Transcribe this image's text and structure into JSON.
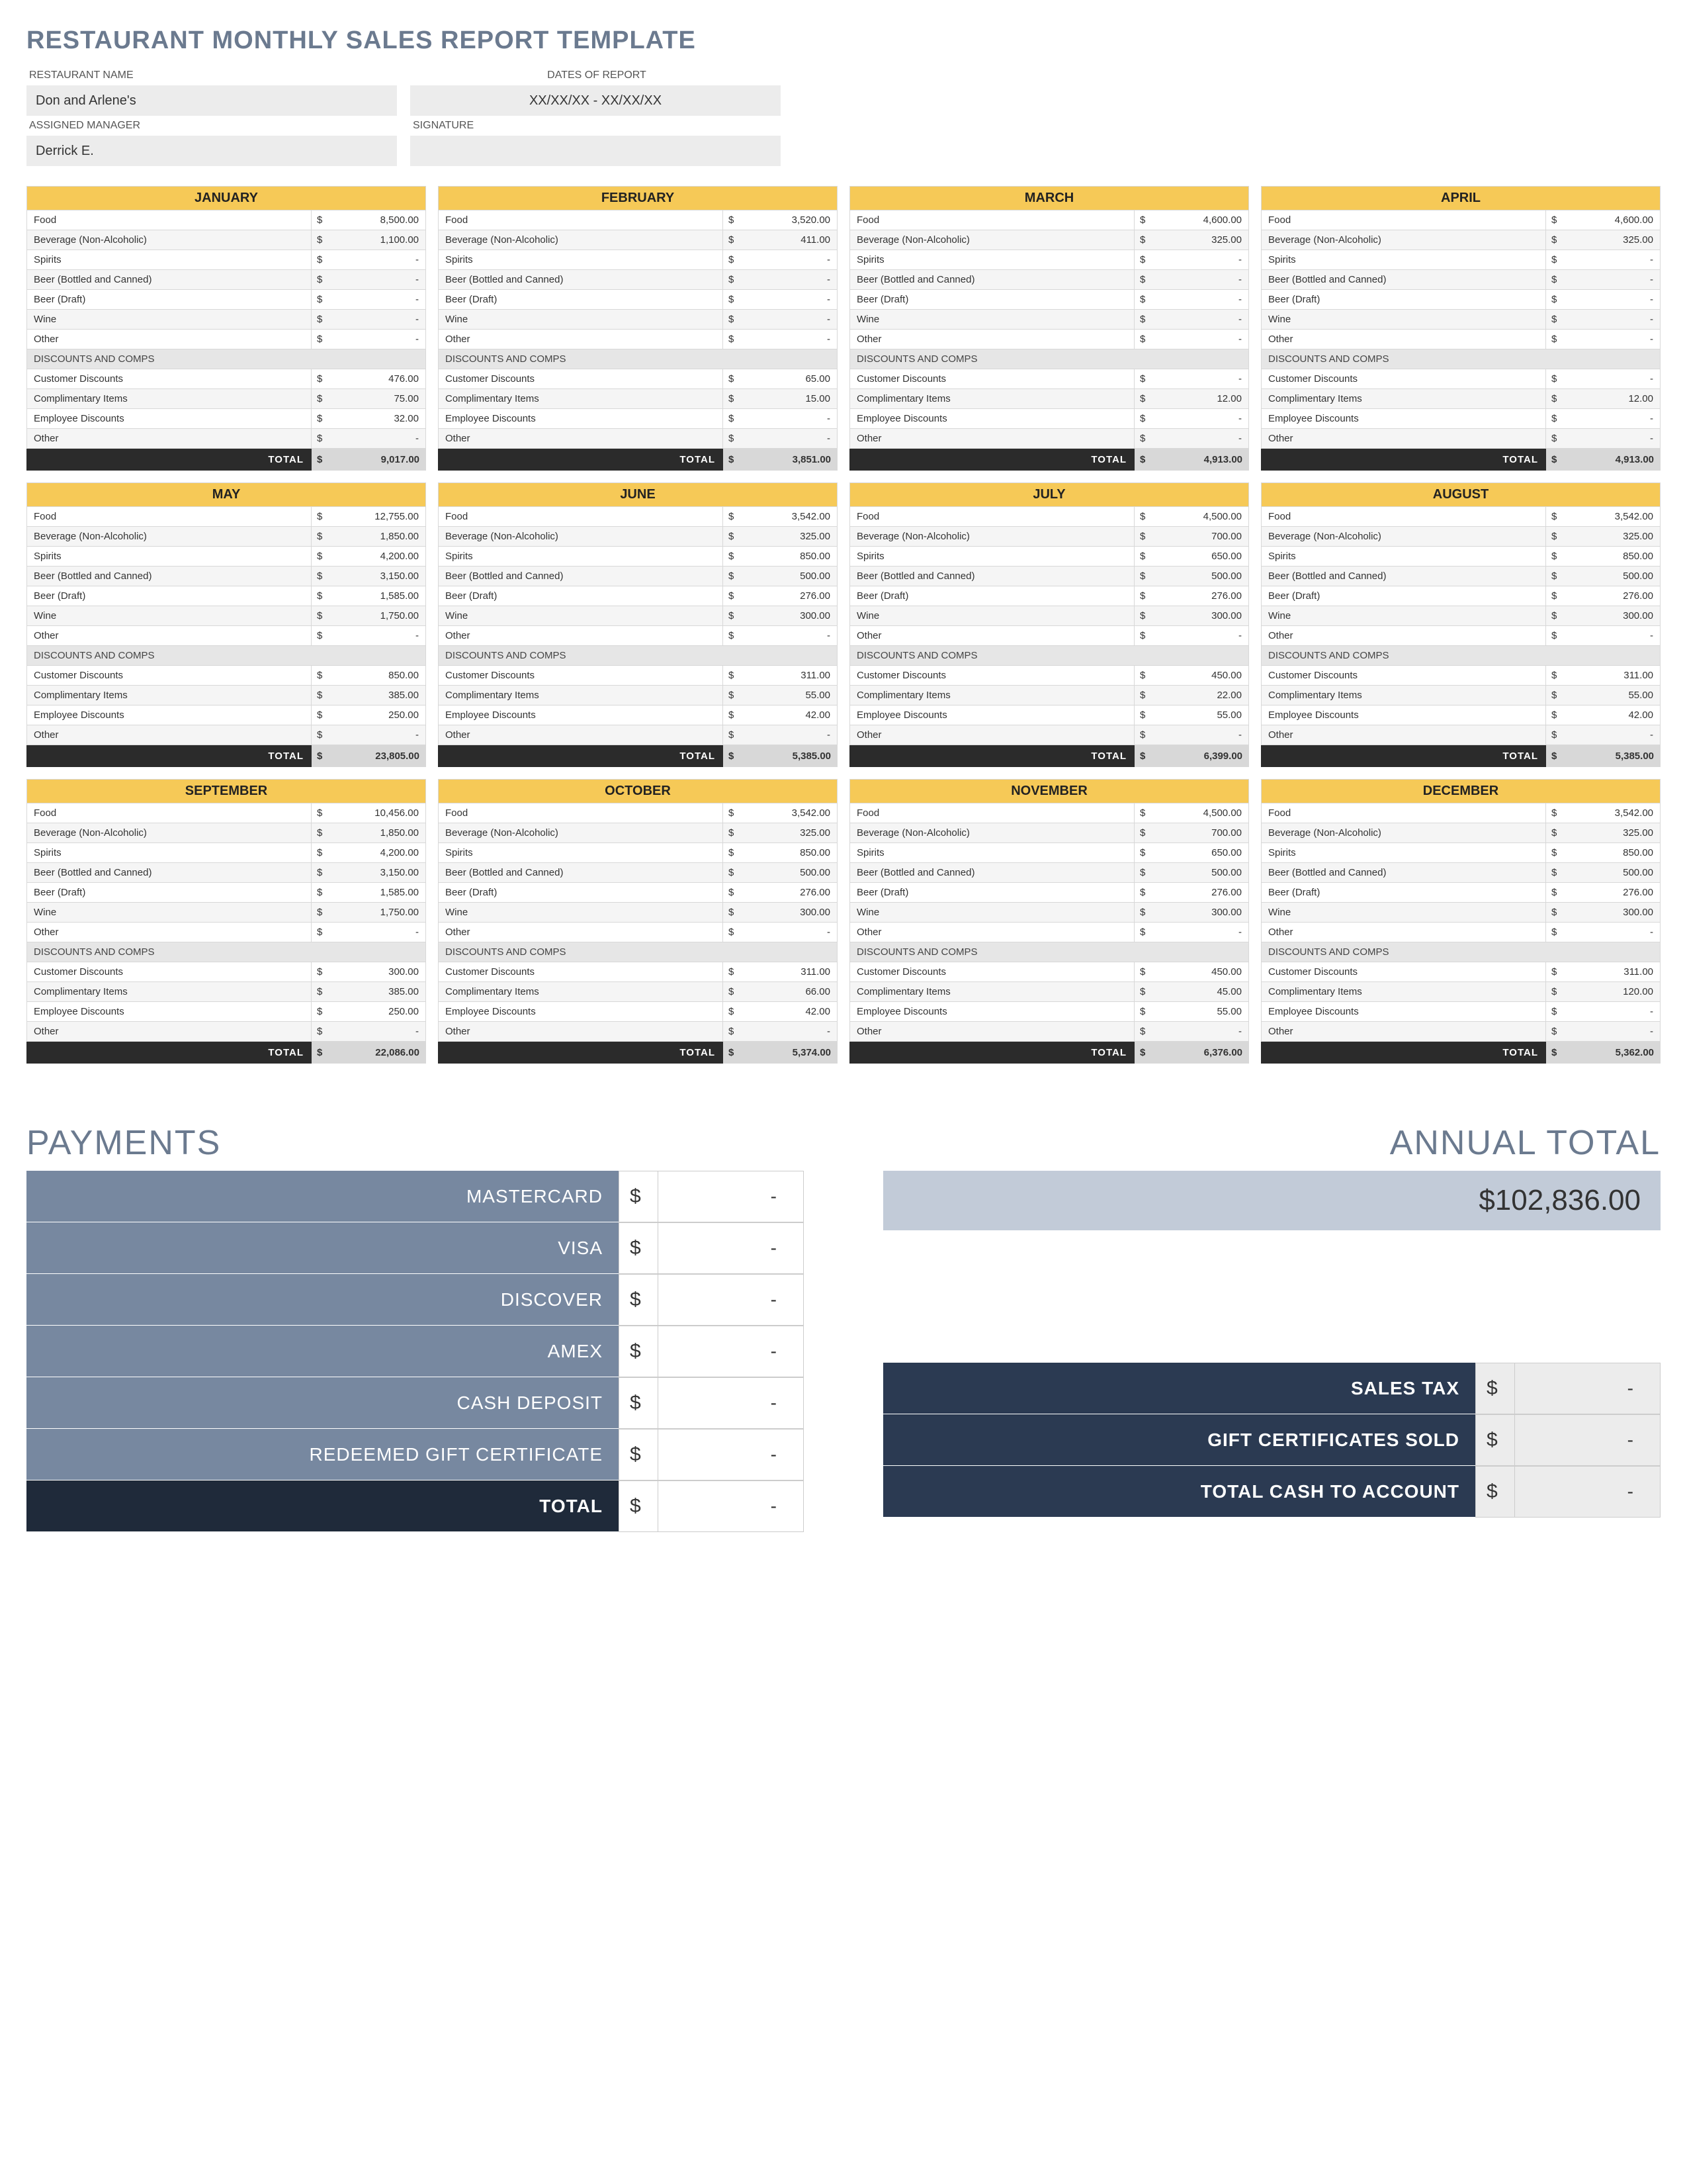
{
  "title": "RESTAURANT MONTHLY SALES REPORT TEMPLATE",
  "fields": {
    "restaurant_label": "RESTAURANT NAME",
    "restaurant_value": "Don and Arlene's",
    "dates_label": "DATES OF REPORT",
    "dates_value": "XX/XX/XX - XX/XX/XX",
    "manager_label": "ASSIGNED MANAGER",
    "manager_value": "Derrick E.",
    "signature_label": "SIGNATURE",
    "signature_value": ""
  },
  "row_labels": {
    "sales": [
      "Food",
      "Beverage (Non-Alcoholic)",
      "Spirits",
      "Beer (Bottled and Canned)",
      "Beer (Draft)",
      "Wine",
      "Other"
    ],
    "disc_head": "DISCOUNTS AND COMPS",
    "discs": [
      "Customer Discounts",
      "Complimentary Items",
      "Employee Discounts",
      "Other"
    ],
    "total": "TOTAL"
  },
  "months": [
    {
      "name": "JANUARY",
      "sales": [
        "8,500.00",
        "1,100.00",
        "-",
        "-",
        "-",
        "-",
        "-"
      ],
      "discs": [
        "476.00",
        "75.00",
        "32.00",
        "-"
      ],
      "total": "9,017.00"
    },
    {
      "name": "FEBRUARY",
      "sales": [
        "3,520.00",
        "411.00",
        "-",
        "-",
        "-",
        "-",
        "-"
      ],
      "discs": [
        "65.00",
        "15.00",
        "-",
        "-"
      ],
      "total": "3,851.00"
    },
    {
      "name": "MARCH",
      "sales": [
        "4,600.00",
        "325.00",
        "-",
        "-",
        "-",
        "-",
        "-"
      ],
      "discs": [
        "-",
        "12.00",
        "-",
        "-"
      ],
      "total": "4,913.00"
    },
    {
      "name": "APRIL",
      "sales": [
        "4,600.00",
        "325.00",
        "-",
        "-",
        "-",
        "-",
        "-"
      ],
      "discs": [
        "-",
        "12.00",
        "-",
        "-"
      ],
      "total": "4,913.00"
    },
    {
      "name": "MAY",
      "sales": [
        "12,755.00",
        "1,850.00",
        "4,200.00",
        "3,150.00",
        "1,585.00",
        "1,750.00",
        "-"
      ],
      "discs": [
        "850.00",
        "385.00",
        "250.00",
        "-"
      ],
      "total": "23,805.00"
    },
    {
      "name": "JUNE",
      "sales": [
        "3,542.00",
        "325.00",
        "850.00",
        "500.00",
        "276.00",
        "300.00",
        "-"
      ],
      "discs": [
        "311.00",
        "55.00",
        "42.00",
        "-"
      ],
      "total": "5,385.00"
    },
    {
      "name": "JULY",
      "sales": [
        "4,500.00",
        "700.00",
        "650.00",
        "500.00",
        "276.00",
        "300.00",
        "-"
      ],
      "discs": [
        "450.00",
        "22.00",
        "55.00",
        "-"
      ],
      "total": "6,399.00"
    },
    {
      "name": "AUGUST",
      "sales": [
        "3,542.00",
        "325.00",
        "850.00",
        "500.00",
        "276.00",
        "300.00",
        "-"
      ],
      "discs": [
        "311.00",
        "55.00",
        "42.00",
        "-"
      ],
      "total": "5,385.00"
    },
    {
      "name": "SEPTEMBER",
      "sales": [
        "10,456.00",
        "1,850.00",
        "4,200.00",
        "3,150.00",
        "1,585.00",
        "1,750.00",
        "-"
      ],
      "discs": [
        "300.00",
        "385.00",
        "250.00",
        "-"
      ],
      "total": "22,086.00"
    },
    {
      "name": "OCTOBER",
      "sales": [
        "3,542.00",
        "325.00",
        "850.00",
        "500.00",
        "276.00",
        "300.00",
        "-"
      ],
      "discs": [
        "311.00",
        "66.00",
        "42.00",
        "-"
      ],
      "total": "5,374.00"
    },
    {
      "name": "NOVEMBER",
      "sales": [
        "4,500.00",
        "700.00",
        "650.00",
        "500.00",
        "276.00",
        "300.00",
        "-"
      ],
      "discs": [
        "450.00",
        "45.00",
        "55.00",
        "-"
      ],
      "total": "6,376.00"
    },
    {
      "name": "DECEMBER",
      "sales": [
        "3,542.00",
        "325.00",
        "850.00",
        "500.00",
        "276.00",
        "300.00",
        "-"
      ],
      "discs": [
        "311.00",
        "120.00",
        "-",
        "-"
      ],
      "total": "5,362.00"
    }
  ],
  "payments": {
    "title": "PAYMENTS",
    "rows": [
      {
        "label": "MASTERCARD",
        "value": "-"
      },
      {
        "label": "VISA",
        "value": "-"
      },
      {
        "label": "DISCOVER",
        "value": "-"
      },
      {
        "label": "AMEX",
        "value": "-"
      },
      {
        "label": "CASH DEPOSIT",
        "value": "-"
      },
      {
        "label": "REDEEMED GIFT CERTIFICATE",
        "value": "-"
      }
    ],
    "total_label": "TOTAL",
    "total_value": "-"
  },
  "annual": {
    "title": "ANNUAL TOTAL",
    "value": "$102,836.00"
  },
  "summary": [
    {
      "label": "SALES TAX",
      "value": "-"
    },
    {
      "label": "GIFT CERTIFICATES SOLD",
      "value": "-"
    },
    {
      "label": "TOTAL CASH TO ACCOUNT",
      "value": "-"
    }
  ],
  "currency": "$"
}
